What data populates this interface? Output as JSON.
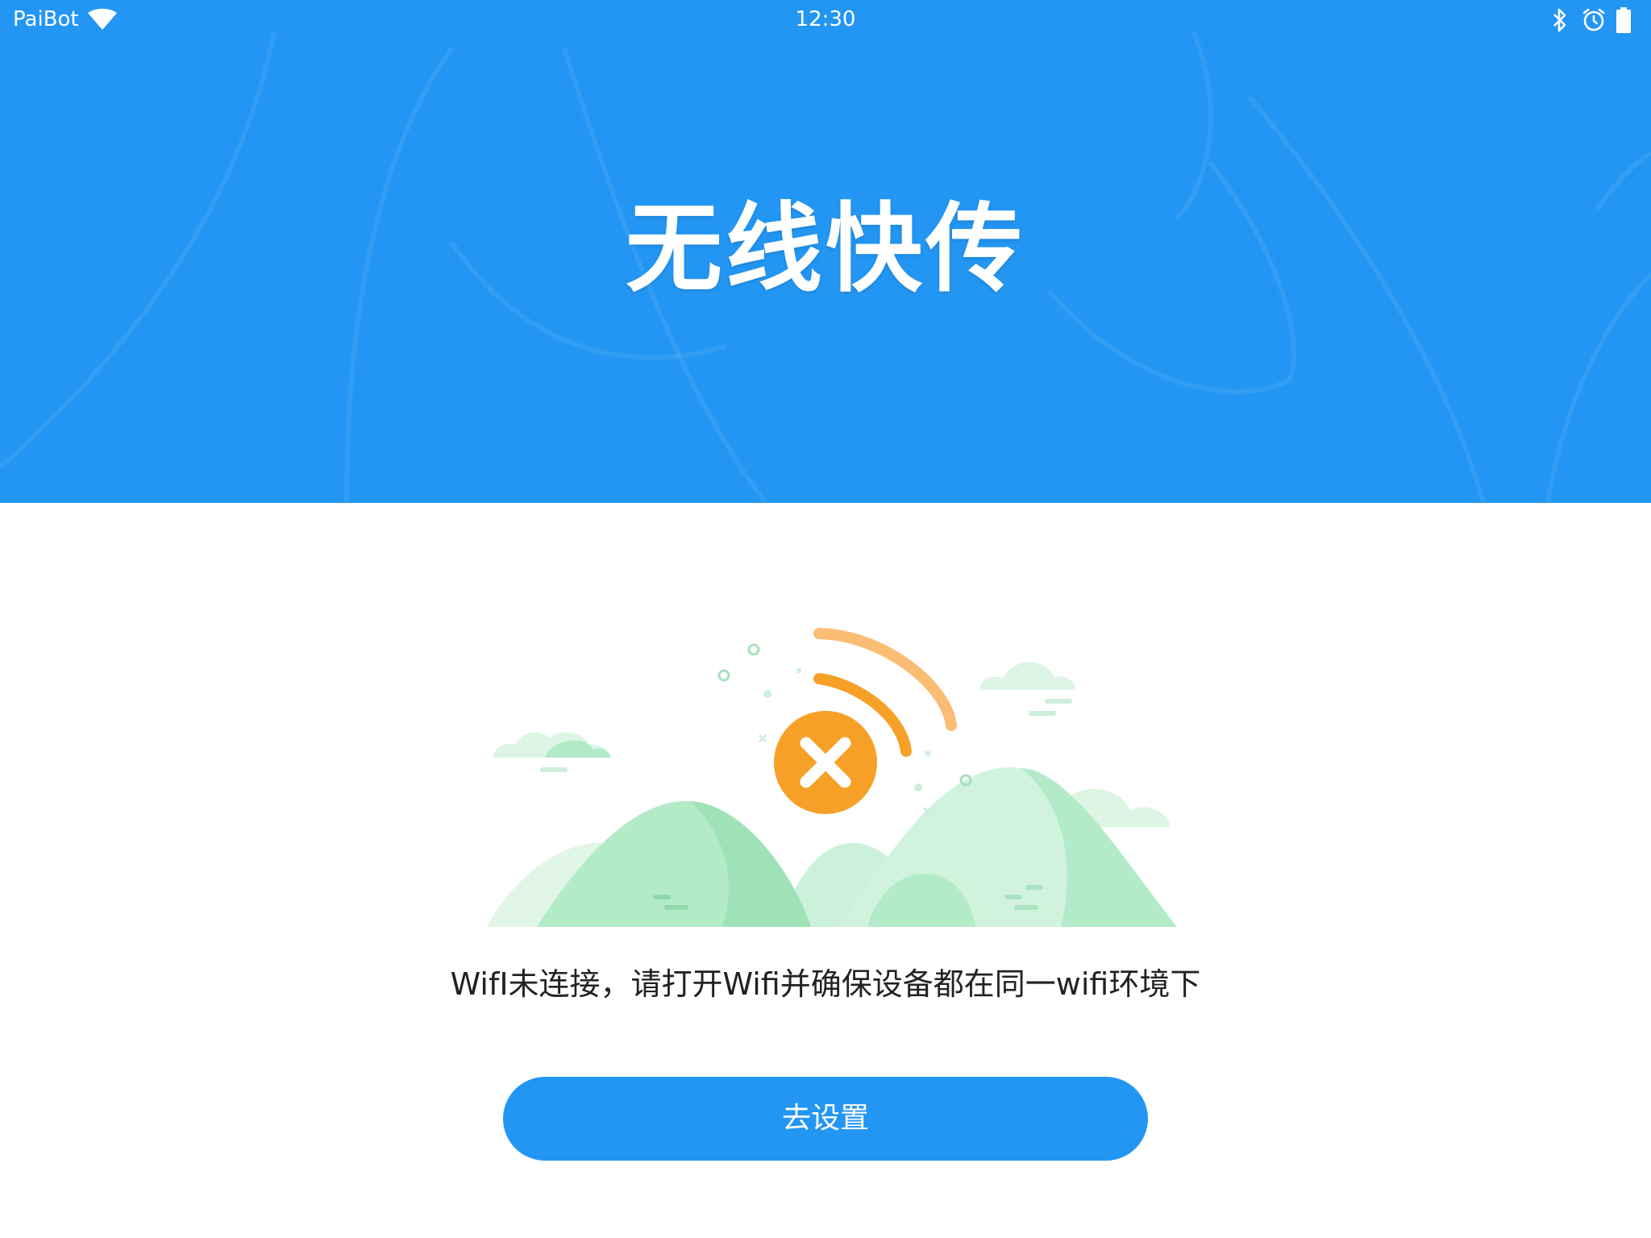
{
  "status_bar": {
    "carrier": "PaiBot",
    "time": "12:30",
    "icons": [
      "wifi-icon",
      "bluetooth-icon",
      "alarm-icon",
      "battery-icon"
    ]
  },
  "header": {
    "title": "无线快传",
    "background_color": "#2396f3"
  },
  "illustration": {
    "icon": "wifi-disconnected-icon",
    "accent_color": "#f7a027",
    "hill_color": "#b3ebc8"
  },
  "message": "WifI未连接，请打开Wifi并确保设备都在同一wifi环境下",
  "settings_button": {
    "label": "去设置",
    "color": "#2396f3"
  }
}
